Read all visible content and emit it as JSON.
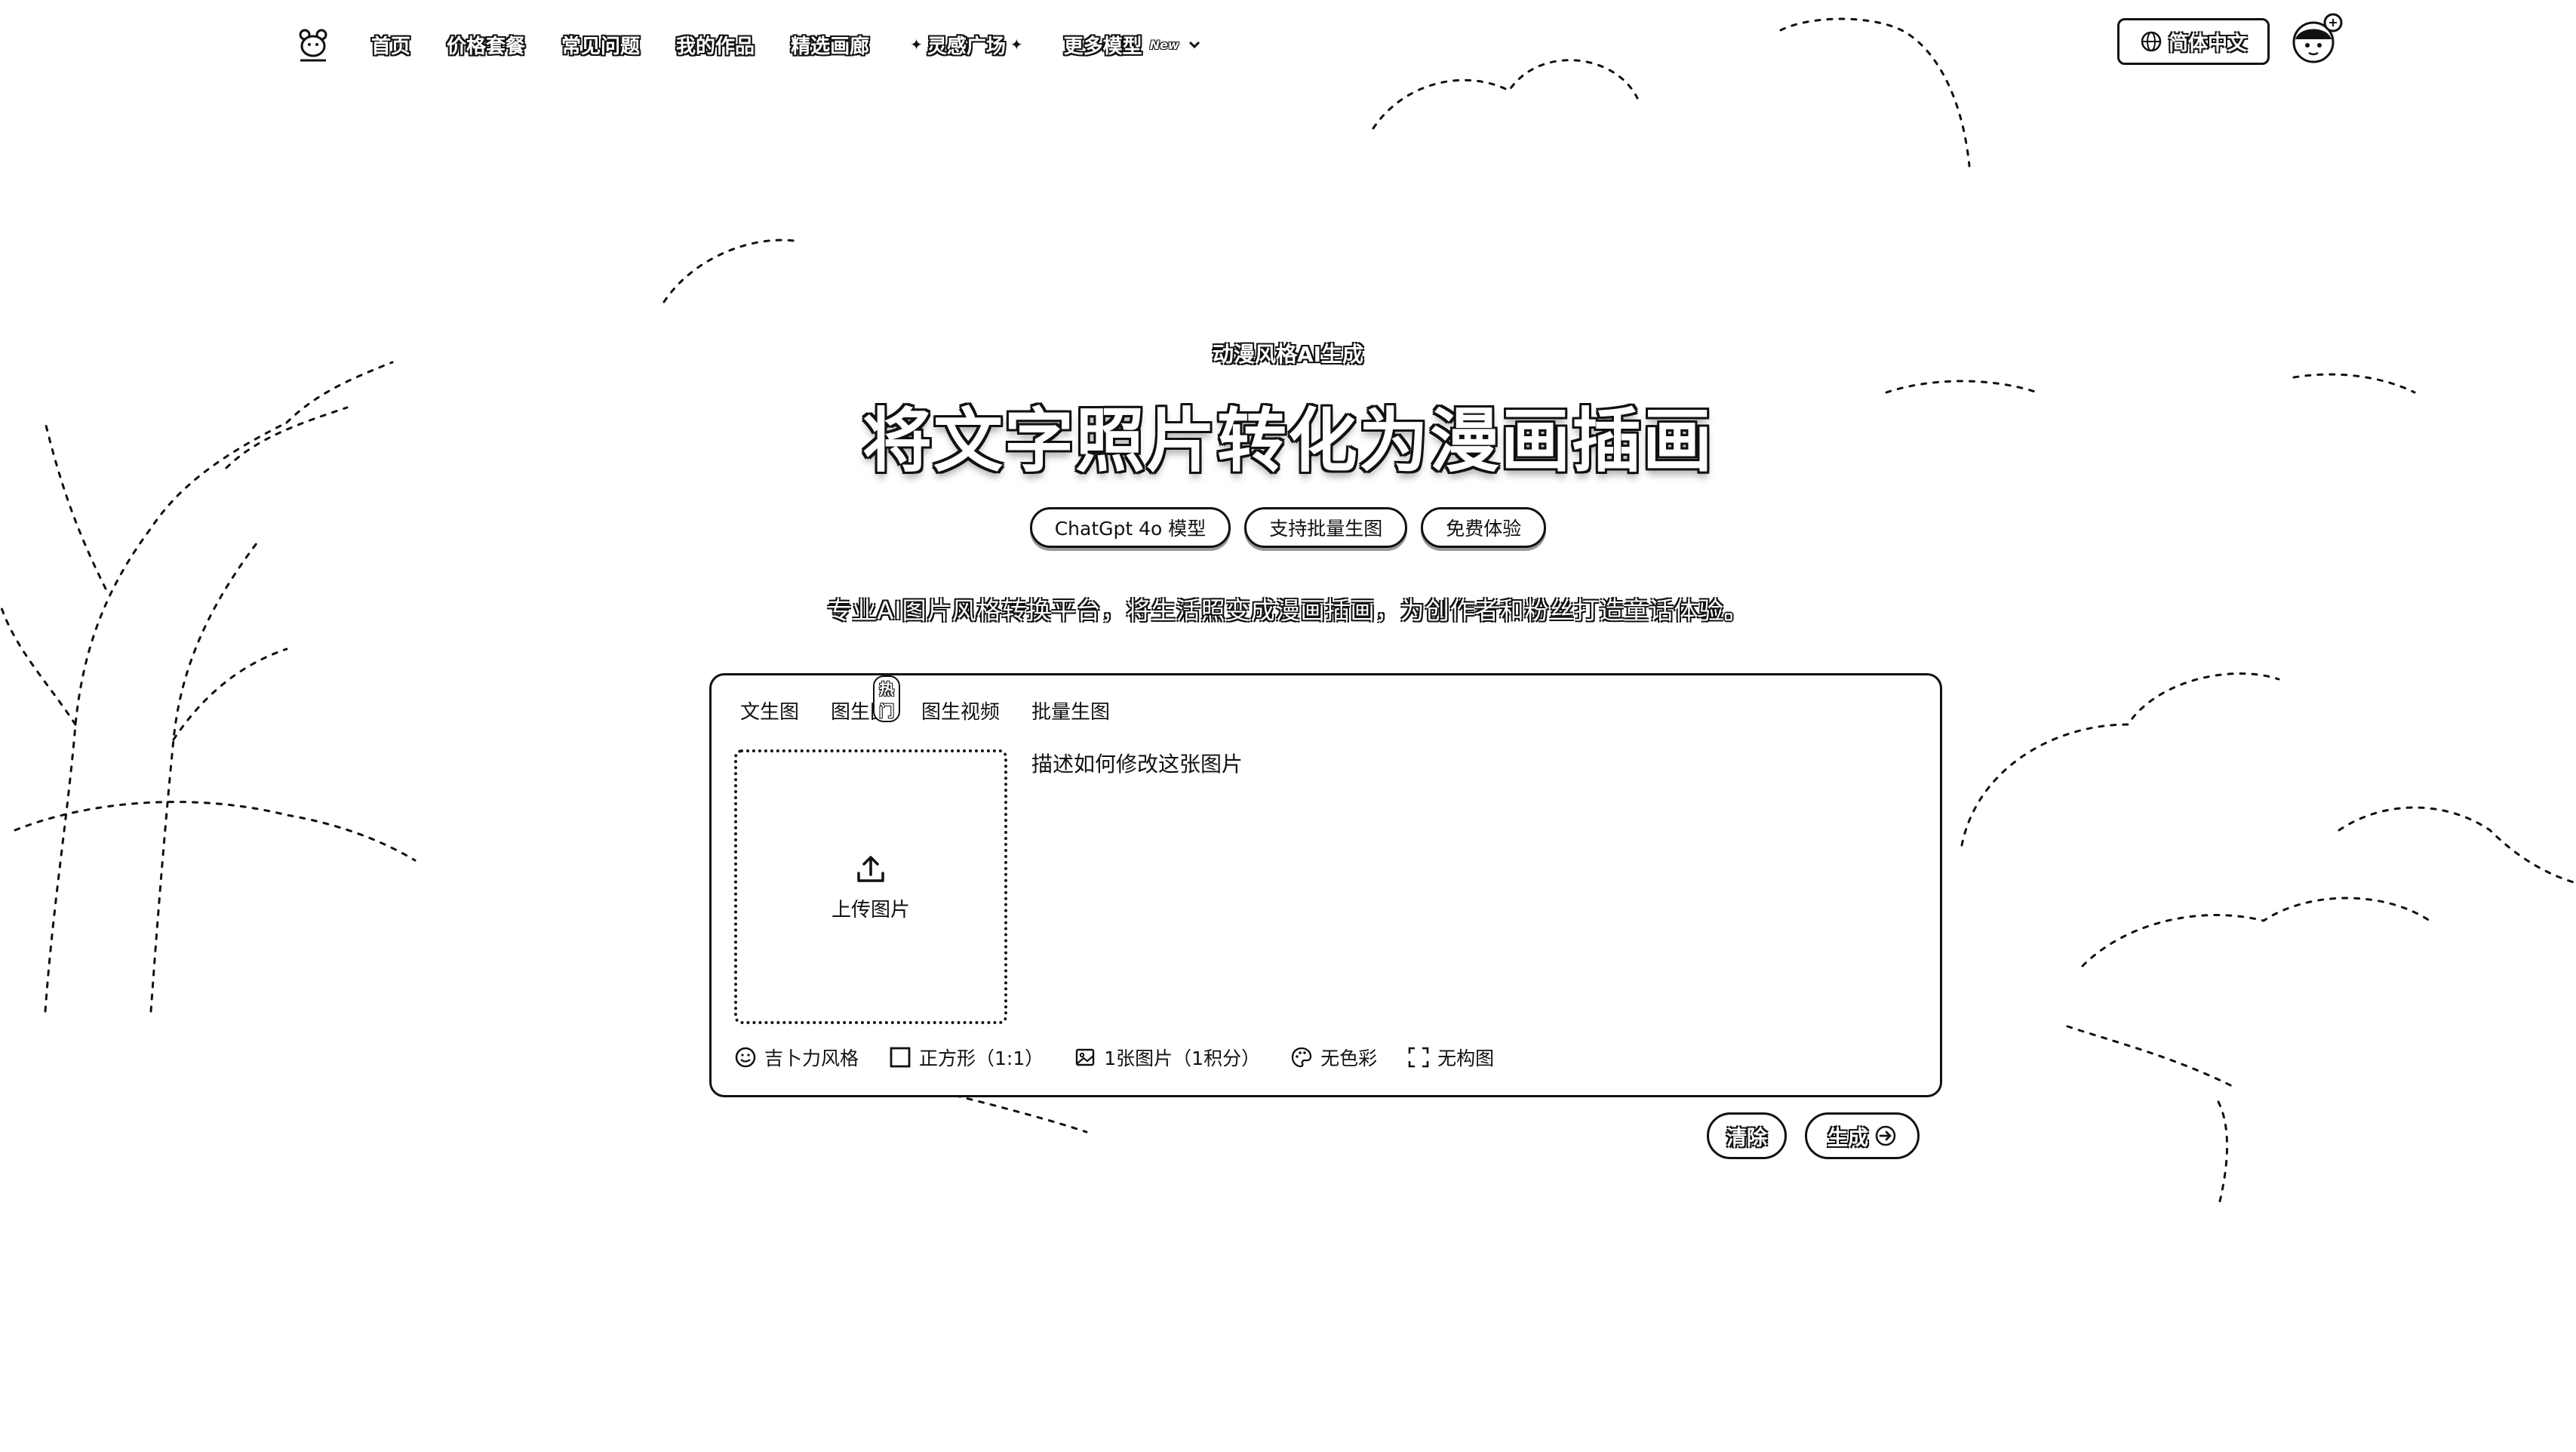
{
  "nav": {
    "items": [
      {
        "label": "首页"
      },
      {
        "label": "价格套餐"
      },
      {
        "label": "常见问题"
      },
      {
        "label": "我的作品"
      },
      {
        "label": "精选画廊"
      },
      {
        "label": "灵感广场"
      },
      {
        "label": "更多模型"
      }
    ],
    "new_tag": "New",
    "language": "简体中文"
  },
  "hero": {
    "eyebrow": "动漫风格AI生成",
    "title": "将文字照片转化为漫画插画",
    "chips": [
      "ChatGpt 4o 模型",
      "支持批量生图",
      "免费体验"
    ],
    "subtitle": "专业AI图片风格转换平台，将生活照变成漫画插画，为创作者和粉丝打造童话体验。"
  },
  "generator": {
    "tabs": [
      {
        "label": "文生图"
      },
      {
        "label": "图生图"
      },
      {
        "label": "图生视频"
      },
      {
        "label": "批量生图"
      }
    ],
    "hot_badge": "热门",
    "upload_label": "上传图片",
    "prompt_placeholder": "描述如何修改这张图片",
    "options": {
      "style": "吉卜力风格",
      "aspect": "正方形（1:1）",
      "count": "1张图片（1积分）",
      "color": "无色彩",
      "composition": "无构图"
    }
  },
  "actions": {
    "clear": "清除",
    "generate": "生成"
  },
  "icons": {
    "logo": "bear-logo-icon",
    "globe": "globe-icon",
    "upload": "upload-icon",
    "arrow": "arrow-right-icon"
  }
}
